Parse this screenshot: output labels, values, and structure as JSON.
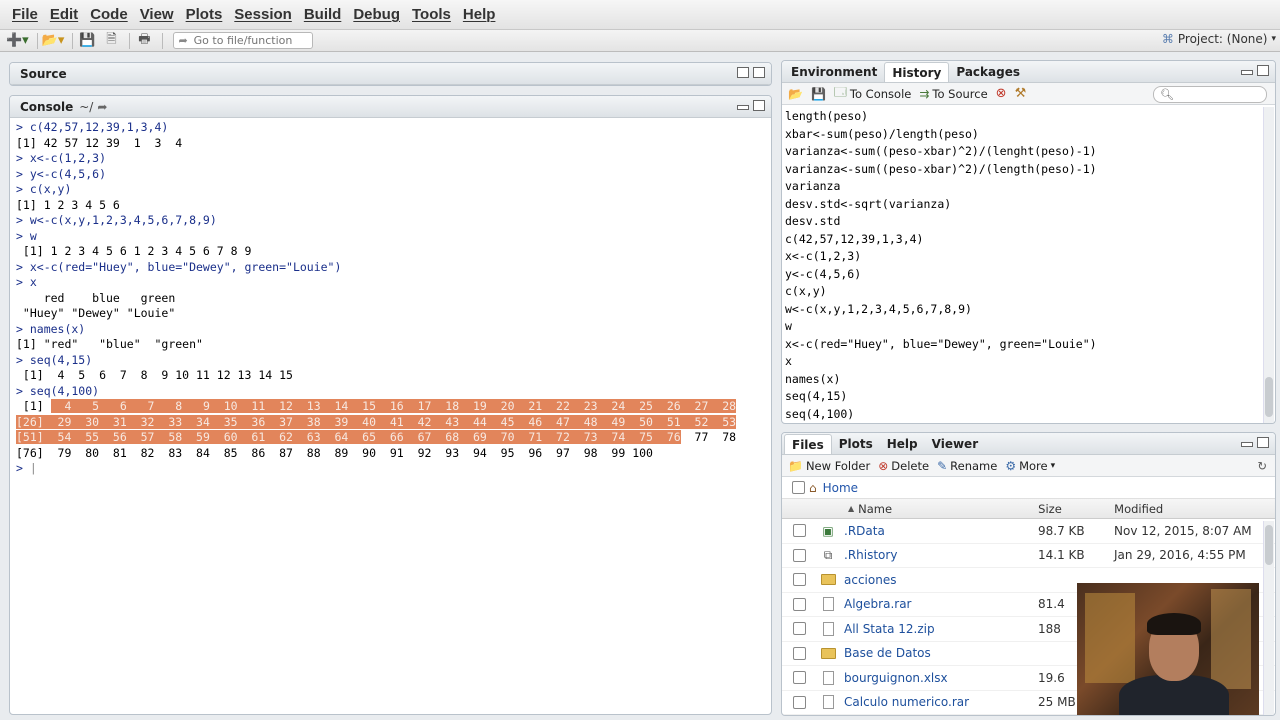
{
  "menubar": {
    "items": [
      "File",
      "Edit",
      "Code",
      "View",
      "Plots",
      "Session",
      "Build",
      "Debug",
      "Tools",
      "Help"
    ]
  },
  "toolbar": {
    "goto_placeholder": "Go to file/function",
    "project": "Project: (None)"
  },
  "source": {
    "title": "Source"
  },
  "console": {
    "title": "Console",
    "path": "~/",
    "lines": [
      {
        "t": "cmd",
        "text": "> c(42,57,12,39,1,3,4)"
      },
      {
        "t": "out",
        "text": "[1] 42 57 12 39  1  3  4"
      },
      {
        "t": "cmd",
        "text": "> x<-c(1,2,3)"
      },
      {
        "t": "cmd",
        "text": "> y<-c(4,5,6)"
      },
      {
        "t": "cmd",
        "text": "> c(x,y)"
      },
      {
        "t": "out",
        "text": "[1] 1 2 3 4 5 6"
      },
      {
        "t": "cmd",
        "text": "> w<-c(x,y,1,2,3,4,5,6,7,8,9)"
      },
      {
        "t": "cmd",
        "text": "> w"
      },
      {
        "t": "out",
        "text": " [1] 1 2 3 4 5 6 1 2 3 4 5 6 7 8 9"
      },
      {
        "t": "cmd",
        "text": "> x<-c(red=\"Huey\", blue=\"Dewey\", green=\"Louie\")"
      },
      {
        "t": "cmd",
        "text": "> x"
      },
      {
        "t": "out",
        "text": "    red    blue   green "
      },
      {
        "t": "out",
        "text": " \"Huey\" \"Dewey\" \"Louie\" "
      },
      {
        "t": "cmd",
        "text": "> names(x)"
      },
      {
        "t": "out",
        "text": "[1] \"red\"   \"blue\"  \"green\""
      },
      {
        "t": "cmd",
        "text": "> seq(4,15)"
      },
      {
        "t": "out",
        "text": " [1]  4  5  6  7  8  9 10 11 12 13 14 15"
      },
      {
        "t": "cmd",
        "text": "> seq(4,100)"
      }
    ],
    "seq_rows": [
      {
        "prefix": " [1] ",
        "hl_prefix": false,
        "hl": "  4   5   6   7   8   9  10  11  12  13  14  15  16  17  18  19  20  21  22  23  24  25  26  27  28",
        "rest": ""
      },
      {
        "prefix": "[26] ",
        "hl_prefix": true,
        "hl": " 29  30  31  32  33  34  35  36  37  38  39  40  41  42  43  44  45  46  47  48  49  50  51  52  53",
        "rest": ""
      },
      {
        "prefix": "[51] ",
        "hl_prefix": true,
        "hl": " 54  55  56  57  58  59  60  61  62  63  64  65  66  67  68  69  70  71  72  73  74  75  76",
        "rest": "  77  78"
      },
      {
        "prefix": "[76] ",
        "hl_prefix": false,
        "hl": "",
        "rest": " 79  80  81  82  83  84  85  86  87  88  89  90  91  92  93  94  95  96  97  98  99 100"
      }
    ],
    "prompt": "> "
  },
  "env_tabs": [
    "Environment",
    "History",
    "Packages"
  ],
  "history_toolbar": {
    "to_console": "To Console",
    "to_source": "To Source"
  },
  "history": [
    "length(peso)",
    "xbar<-sum(peso)/length(peso)",
    "varianza<-sum((peso-xbar)^2)/(lenght(peso)-1)",
    "varianza<-sum((peso-xbar)^2)/(length(peso)-1)",
    "varianza",
    "desv.std<-sqrt(varianza)",
    "desv.std",
    "c(42,57,12,39,1,3,4)",
    "x<-c(1,2,3)",
    "y<-c(4,5,6)",
    "c(x,y)",
    "w<-c(x,y,1,2,3,4,5,6,7,8,9)",
    "w",
    "x<-c(red=\"Huey\", blue=\"Dewey\", green=\"Louie\")",
    "x",
    "names(x)",
    "seq(4,15)",
    "seq(4,100)"
  ],
  "files_tabs": [
    "Files",
    "Plots",
    "Help",
    "Viewer"
  ],
  "files_toolbar": {
    "new_folder": "New Folder",
    "delete": "Delete",
    "rename": "Rename",
    "more": "More"
  },
  "files_crumb": "Home",
  "files_columns": {
    "name": "Name",
    "size": "Size",
    "modified": "Modified"
  },
  "files": [
    {
      "name": ".RData",
      "size": "98.7 KB",
      "modified": "Nov 12, 2015, 8:07 AM",
      "icon": "rdata-icon"
    },
    {
      "name": ".Rhistory",
      "size": "14.1 KB",
      "modified": "Jan 29, 2016, 4:55 PM",
      "icon": "rhistory-icon"
    },
    {
      "name": "acciones",
      "size": "",
      "modified": "",
      "icon": "folder-icon"
    },
    {
      "name": "Algebra.rar",
      "size": "81.4",
      "modified": "",
      "icon": "file-icon"
    },
    {
      "name": "All Stata 12.zip",
      "size": "188",
      "modified": "",
      "icon": "file-icon"
    },
    {
      "name": "Base de Datos",
      "size": "",
      "modified": "",
      "icon": "folder-icon"
    },
    {
      "name": "bourguignon.xlsx",
      "size": "19.6",
      "modified": "",
      "icon": "file-icon"
    },
    {
      "name": "Calculo numerico.rar",
      "size": "25 MB",
      "modified": "",
      "icon": "file-icon"
    }
  ]
}
